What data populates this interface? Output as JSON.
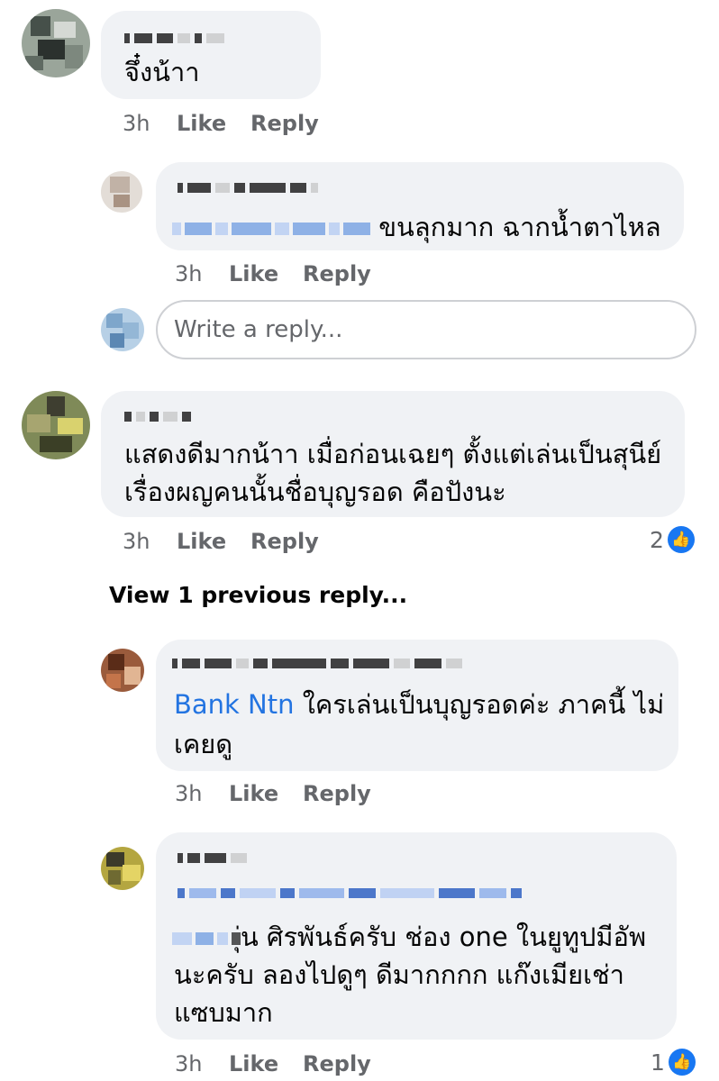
{
  "comments": [
    {
      "text_lines": [
        "จึ๋งน้าา"
      ],
      "time": "3h",
      "like": "Like",
      "reply": "Reply"
    },
    {
      "mention_suffix": "ขนลุกมาก ฉากน้ำตาไหล",
      "time": "3h",
      "like": "Like",
      "reply": "Reply"
    },
    {
      "text_lines": [
        "แสดงดีมากน้าา เมื่อก่อนเฉยๆ ตั้งแต่เล่นเป็นสุนีย์",
        "เรื่องผญคนนั้นชื่อบุญรอด คือปังนะ"
      ],
      "time": "3h",
      "like": "Like",
      "reply": "Reply",
      "reactions": "2"
    },
    {
      "mention": "Bank Ntn",
      "text_line1": " ใครเล่นเป็นบุญรอดค่ะ ภาคนี้ ไม่",
      "text_line2": "เคยดู",
      "time": "3h",
      "like": "Like",
      "reply": "Reply"
    },
    {
      "text_line1": "ุ่น ศิรพันธ์ครับ ช่อง one ในยูทูปมีอัพ",
      "text_line2": "นะครับ ลองไปดูๆ ดีมากกกก แก๊งเมียเช่า",
      "text_line3": "แซบมาก",
      "time": "3h",
      "like": "Like",
      "reply": "Reply",
      "reactions": "1"
    }
  ],
  "reply_box": {
    "placeholder": "Write a reply..."
  },
  "view_previous": "View 1 previous reply...",
  "icons": {
    "like_badge": "thumbs-up-icon"
  },
  "colors": {
    "bubble": "#f0f2f5",
    "mention": "#2374e1",
    "meta": "#65676b",
    "like_badge": "#1877f2"
  }
}
